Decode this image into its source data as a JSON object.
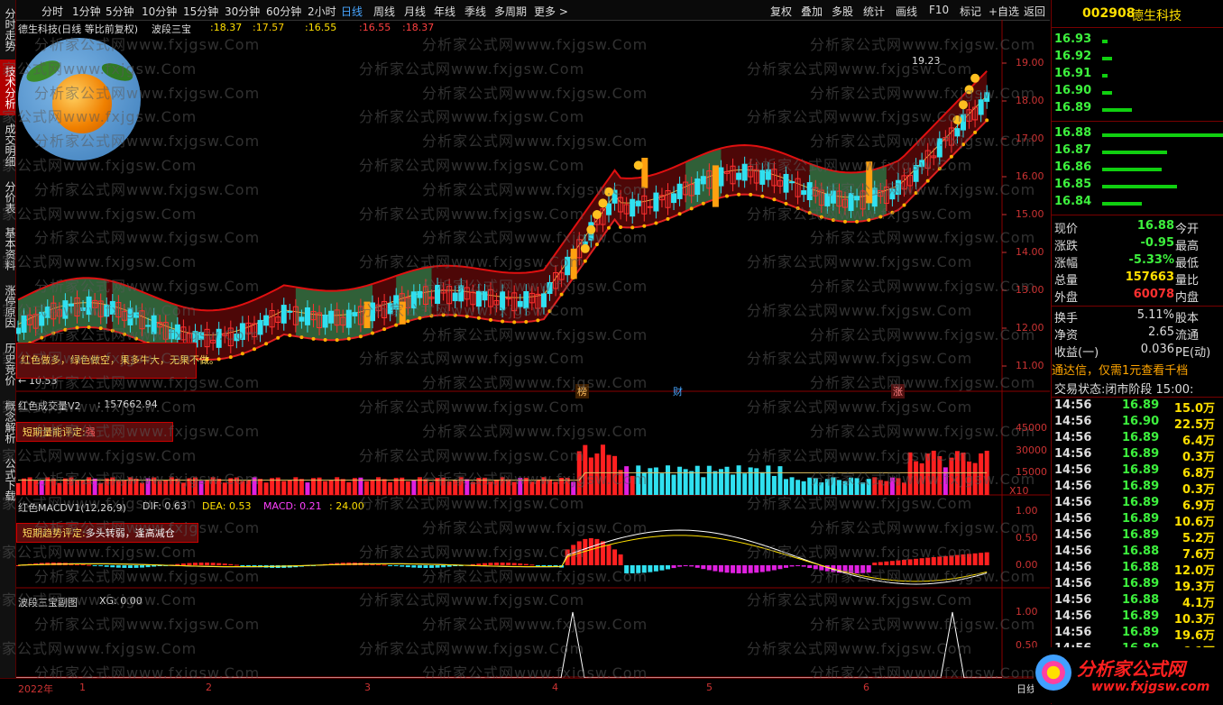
{
  "toolbar": {
    "periods": [
      "分时",
      "1分钟",
      "5分钟",
      "10分钟",
      "15分钟",
      "30分钟",
      "60分钟",
      "2小时",
      "日线",
      "周线",
      "月线",
      "年线",
      "季线",
      "多周期",
      "更多 >"
    ],
    "active": "日线",
    "actions": [
      "复权",
      "叠加",
      "多股",
      "统计",
      "画线",
      "F10",
      "标记",
      "+自选",
      "返回"
    ]
  },
  "sidebar": {
    "tabs": [
      "分时走势",
      "技术分析",
      "成交明细",
      "分价表",
      "基本资料",
      "涨停原因",
      "历史竞价",
      "概念解析",
      "公式下载"
    ],
    "active": "技术分析"
  },
  "main_panel": {
    "title": "德生科技(日线 等比前复权)",
    "indicator": "波段三宝",
    "values": [
      ":18.37",
      ":17.57",
      ":16.55",
      ":16.55",
      ":18.37"
    ],
    "y_ticks": [
      "19.00",
      "18.00",
      "17.00",
      "16.00",
      "15.00",
      "14.00",
      "13.00",
      "12.00",
      "11.00"
    ],
    "high_label": "19.23",
    "low_label": "10.53",
    "advice": "红色做多，绿色做空，果多牛大，无果不做。",
    "event_marks": [
      "榜",
      "财",
      "涨"
    ]
  },
  "volume_panel": {
    "title": "红色成交量V2",
    "value": ": 157662.94",
    "badge_label": "短期量能评定:",
    "badge_value": "强",
    "y_ticks": [
      "45000",
      "30000",
      "15000"
    ],
    "unit": "X10"
  },
  "macd_panel": {
    "title": "红色MACDV1(12,26,9)",
    "dif": "DIF: 0.63",
    "dea": "DEA: 0.53",
    "macd": "MACD: 0.21",
    "extra": ": 24.00",
    "badge_label": "短期趋势评定:",
    "badge_value": "多头转弱，逢高减仓",
    "y_ticks": [
      "1.00",
      "0.50",
      "0.00"
    ]
  },
  "sub_panel": {
    "title": "波段三宝副图",
    "value": "XG: 0.00",
    "y_ticks": [
      "1.00",
      "0.50"
    ]
  },
  "x_axis": {
    "year": "2022年",
    "months": [
      "1",
      "2",
      "3",
      "4",
      "5",
      "6"
    ],
    "period_label": "日线"
  },
  "watermark": "分析家公式网www.fxjgsw.Com",
  "quote": {
    "code": "002908",
    "name": "德生科技",
    "asks": [
      {
        "price": "16.93",
        "level": 1
      },
      {
        "price": "16.92",
        "level": 2
      },
      {
        "price": "16.91",
        "level": 1
      },
      {
        "price": "16.90",
        "level": 2
      },
      {
        "price": "16.89",
        "level": 6
      }
    ],
    "bids": [
      {
        "price": "16.88",
        "level": 28
      },
      {
        "price": "16.87",
        "level": 13
      },
      {
        "price": "16.86",
        "level": 12
      },
      {
        "price": "16.85",
        "level": 15
      },
      {
        "price": "16.84",
        "level": 8
      }
    ],
    "stats": [
      {
        "l": "现价",
        "v": "16.88",
        "r": "今开",
        "c": "g"
      },
      {
        "l": "涨跌",
        "v": "-0.95",
        "r": "最高",
        "c": "g"
      },
      {
        "l": "涨幅",
        "v": "-5.33%",
        "r": "最低",
        "c": "g"
      },
      {
        "l": "总量",
        "v": "157663",
        "r": "量比",
        "c": "y"
      },
      {
        "l": "外盘",
        "v": "60078",
        "r": "内盘",
        "c": "r"
      }
    ],
    "stats2": [
      {
        "l": "换手",
        "v": "5.11%",
        "r": "股本"
      },
      {
        "l": "净资",
        "v": "2.65",
        "r": "流通"
      },
      {
        "l": "收益(一)",
        "v": "0.036",
        "r": "PE(动)"
      }
    ],
    "promo": "通达信，仅需1元查看千档",
    "status_label": "交易状态:",
    "status_value": "闭市阶段 15:00:",
    "ticks": [
      {
        "t": "14:56",
        "p": "16.89",
        "v": "15.0万"
      },
      {
        "t": "14:56",
        "p": "16.90",
        "v": "22.5万"
      },
      {
        "t": "14:56",
        "p": "16.89",
        "v": "6.4万"
      },
      {
        "t": "14:56",
        "p": "16.89",
        "v": "0.3万"
      },
      {
        "t": "14:56",
        "p": "16.89",
        "v": "6.8万"
      },
      {
        "t": "14:56",
        "p": "16.89",
        "v": "0.3万"
      },
      {
        "t": "14:56",
        "p": "16.89",
        "v": "6.9万"
      },
      {
        "t": "14:56",
        "p": "16.89",
        "v": "10.6万"
      },
      {
        "t": "14:56",
        "p": "16.89",
        "v": "5.2万"
      },
      {
        "t": "14:56",
        "p": "16.88",
        "v": "7.6万"
      },
      {
        "t": "14:56",
        "p": "16.88",
        "v": "12.0万"
      },
      {
        "t": "14:56",
        "p": "16.89",
        "v": "19.3万"
      },
      {
        "t": "14:56",
        "p": "16.88",
        "v": "4.1万"
      },
      {
        "t": "14:56",
        "p": "16.89",
        "v": "10.3万"
      },
      {
        "t": "14:56",
        "p": "16.89",
        "v": "19.6万"
      },
      {
        "t": "14:56",
        "p": "16.89",
        "v": "6.1万"
      }
    ]
  },
  "logo": {
    "text": "分析家公式网",
    "url_text": "www.fxjgsw.com"
  },
  "colors": {
    "up": "#ff2020",
    "down": "#30e0f0",
    "green_zone": "#2e6a3e",
    "red_zone": "#6a0a0a",
    "accent": "#ffe000"
  }
}
